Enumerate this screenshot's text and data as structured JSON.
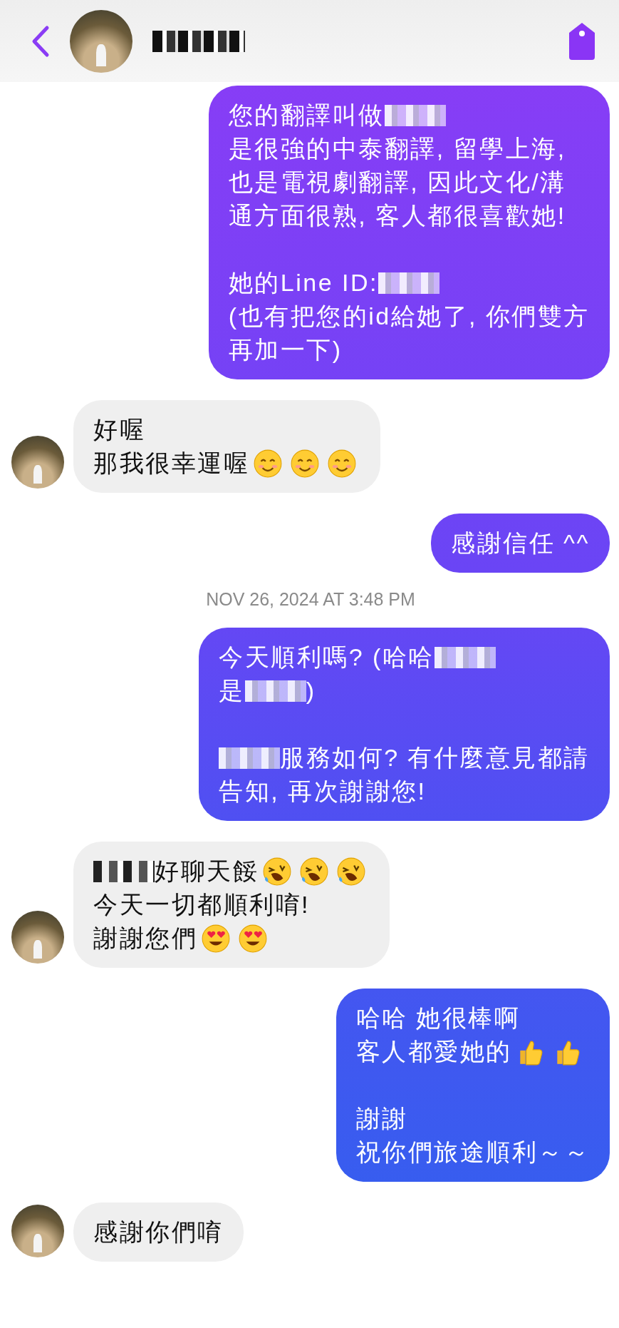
{
  "items": [
    {
      "kind": "message",
      "from_me": true,
      "paragraphs": [
        [
          [
            {
              "kind": "text",
              "text": "您的翻譯叫做"
            },
            {
              "kind": "redacted"
            }
          ],
          [
            {
              "kind": "text",
              "text": "是很強的中泰翻譯, 留學上海,"
            }
          ],
          [
            {
              "kind": "text",
              "text": "也是電視劇翻譯, 因此文化/溝"
            }
          ],
          [
            {
              "kind": "text",
              "text": "通方面很熟, 客人都很喜歡她!"
            }
          ]
        ],
        [
          [
            {
              "kind": "text",
              "text": "她的Line ID: "
            },
            {
              "kind": "redacted"
            }
          ],
          [
            {
              "kind": "text",
              "text": "(也有把您的id給她了, 你們雙方"
            }
          ],
          [
            {
              "kind": "text",
              "text": "再加一下)"
            }
          ]
        ]
      ]
    },
    {
      "kind": "message",
      "from_me": false,
      "show_avatar": true,
      "paragraphs": [
        [
          [
            {
              "kind": "text",
              "text": "好喔"
            }
          ],
          [
            {
              "kind": "text",
              "text": "那我很幸運喔"
            },
            {
              "kind": "smile"
            },
            {
              "kind": "smile"
            },
            {
              "kind": "smile"
            }
          ]
        ]
      ]
    },
    {
      "kind": "message",
      "from_me": true,
      "paragraphs": [
        [
          [
            {
              "kind": "text",
              "text": "感謝信任 ^^"
            }
          ]
        ]
      ]
    },
    {
      "kind": "timestamp",
      "text": "NOV 26, 2024 AT 3:48 PM"
    },
    {
      "kind": "message",
      "from_me": true,
      "paragraphs": [
        [
          [
            {
              "kind": "text",
              "text": "今天順利嗎? (哈哈 "
            },
            {
              "kind": "redacted"
            }
          ],
          [
            {
              "kind": "text",
              "text": "是"
            },
            {
              "kind": "redacted"
            },
            {
              "kind": "text",
              "text": ")"
            }
          ]
        ],
        [
          [
            {
              "kind": "redacted"
            },
            {
              "kind": "text",
              "text": "服務如何? 有什麼意見都請"
            }
          ],
          [
            {
              "kind": "text",
              "text": "告知, 再次謝謝您!"
            }
          ]
        ]
      ]
    },
    {
      "kind": "message",
      "from_me": false,
      "show_avatar": true,
      "paragraphs": [
        [
          [
            {
              "kind": "redacted"
            },
            {
              "kind": "text",
              "text": "好聊天餒 "
            },
            {
              "kind": "laugh"
            },
            {
              "kind": "laugh"
            },
            {
              "kind": "laugh"
            }
          ],
          [
            {
              "kind": "text",
              "text": "今天一切都順利唷!"
            }
          ],
          [
            {
              "kind": "text",
              "text": "謝謝您們 "
            },
            {
              "kind": "heart-eyes"
            },
            {
              "kind": "heart-eyes"
            }
          ]
        ]
      ]
    },
    {
      "kind": "message",
      "from_me": true,
      "paragraphs": [
        [
          [
            {
              "kind": "text",
              "text": "哈哈 她很棒啊"
            }
          ],
          [
            {
              "kind": "text",
              "text": "客人都愛她的 "
            },
            {
              "kind": "thumbs-up"
            },
            {
              "kind": "thumbs-up"
            }
          ]
        ],
        [
          [
            {
              "kind": "text",
              "text": "謝謝"
            }
          ],
          [
            {
              "kind": "text",
              "text": "祝你們旅途順利～～"
            }
          ]
        ]
      ]
    },
    {
      "kind": "message",
      "from_me": false,
      "show_avatar": true,
      "paragraphs": [
        [
          [
            {
              "kind": "text",
              "text": "感謝你們唷"
            }
          ]
        ]
      ]
    }
  ]
}
